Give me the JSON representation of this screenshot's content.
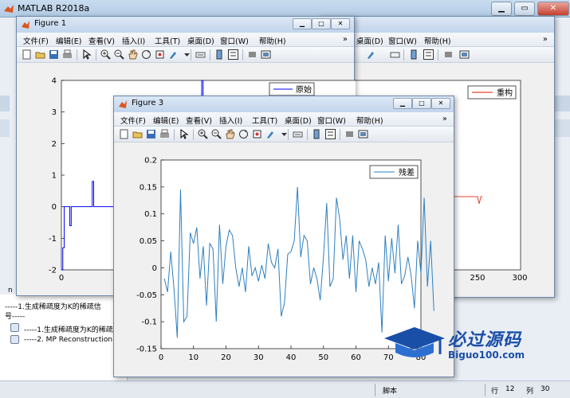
{
  "app": {
    "title": "MATLAB R2018a"
  },
  "menu_labels": [
    "文件(F)",
    "编辑(E)",
    "查看(V)",
    "插入(I)",
    "工具(T)",
    "桌面(D)",
    "窗口(W)",
    "帮助(H)"
  ],
  "figures": {
    "fig1": {
      "title": "Figure 1",
      "legend": "原始"
    },
    "fig2": {
      "legend": "重构"
    },
    "fig3": {
      "title": "Figure 3",
      "legend": "残差"
    }
  },
  "command_window": {
    "line1": "-----1.生成稀疏度为K的稀疏信",
    "line2": "号-----",
    "line3": "-----1.生成稀疏度为K的稀疏",
    "line4": "-----2. MP Reconstruction",
    "left_letter": "n"
  },
  "status_bar": {
    "mode": "脚本",
    "row_label": "行",
    "row": "12",
    "col_label": "列",
    "col": "30"
  },
  "watermark": {
    "main": "必过源码",
    "sub": "Biguo100.com"
  },
  "colors": {
    "fig1_line": "#0000ff",
    "fig2_line": "#e8432e",
    "fig3_line": "#2e7fc0",
    "title_bar": "#c2d5ec"
  },
  "chart_data": [
    {
      "id": "figure-1",
      "type": "line",
      "series": [
        {
          "name": "原始",
          "x": [
            0,
            1,
            1,
            2,
            2,
            3,
            3,
            5,
            5,
            6,
            6,
            7,
            7,
            12,
            12,
            13,
            13,
            22,
            22,
            23,
            23,
            40,
            40,
            41,
            41,
            50,
            50,
            51,
            51,
            52,
            52,
            100,
            100,
            101,
            101,
            200,
            200,
            201,
            201,
            256
          ],
          "y": [
            -2,
            -2,
            -1.3,
            -1.3,
            0,
            0,
            0,
            0,
            0,
            0,
            -0.6,
            -0.6,
            0,
            0,
            0,
            0,
            0,
            0,
            0.8,
            0.8,
            0,
            0,
            2,
            2,
            0,
            0,
            0,
            0,
            0,
            0,
            0,
            0,
            4,
            4,
            0,
            0,
            0,
            0,
            0,
            0
          ]
        }
      ],
      "ylim": [
        -2,
        4
      ],
      "yticks": [
        "4",
        "3",
        "2",
        "1",
        "0",
        "-1",
        "-2"
      ],
      "xticks": [
        "0",
        "50"
      ]
    },
    {
      "id": "figure-2",
      "type": "line",
      "series": [
        {
          "name": "重构",
          "x": [
            0,
            250,
            252,
            254,
            256
          ],
          "y": [
            0,
            0,
            -0.15,
            0,
            0
          ]
        }
      ],
      "xticks": [
        "250",
        "300"
      ]
    },
    {
      "id": "figure-3",
      "type": "line",
      "xlim": [
        0,
        80
      ],
      "ylim": [
        -0.15,
        0.2
      ],
      "xticks": [
        "0",
        "10",
        "20",
        "30",
        "40",
        "50",
        "60",
        "70",
        "80"
      ],
      "yticks": [
        "0.2",
        "0.15",
        "0.1",
        "0.05",
        "0",
        "-0.05",
        "-0.1",
        "-0.15"
      ],
      "series": [
        {
          "name": "残差",
          "values": [
            -0.02,
            -0.045,
            0.03,
            -0.04,
            -0.13,
            0.145,
            -0.1,
            -0.09,
            0.065,
            0.045,
            0.075,
            -0.02,
            0.04,
            -0.07,
            0.045,
            0.035,
            -0.1,
            0.08,
            -0.03,
            0.04,
            0.07,
            0.06,
            0.0,
            -0.035,
            0.0,
            -0.045,
            0.04,
            -0.015,
            0.0,
            -0.025,
            0.005,
            -0.02,
            0.045,
            0.01,
            0.0,
            0.035,
            -0.09,
            -0.065,
            0.025,
            0.03,
            0.05,
            0.15,
            0.02,
            0.06,
            0.05,
            -0.03,
            0.0,
            -0.02,
            -0.06,
            0.02,
            0.12,
            -0.035,
            -0.02,
            0.13,
            0.09,
            0.015,
            0.06,
            -0.02,
            0.06,
            -0.045,
            0.05,
            0.035,
            0.015,
            -0.035,
            0.0,
            -0.03,
            0.01,
            -0.12,
            0.06,
            -0.025,
            0.055,
            -0.01,
            0.08,
            -0.03,
            -0.015,
            0.02,
            -0.015,
            -0.075,
            0.05,
            -0.01,
            0.13,
            -0.035,
            0.05,
            -0.08
          ]
        }
      ]
    }
  ]
}
